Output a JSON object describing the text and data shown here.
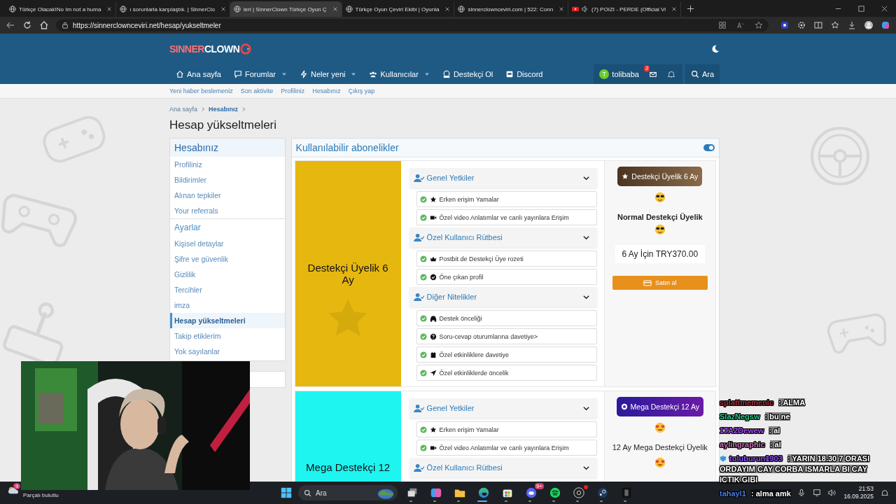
{
  "browser": {
    "tabs": [
      {
        "title": "Türkçe Olacak!No Im not a huma",
        "kind": "page",
        "selected": false,
        "audio": false
      },
      {
        "title": "ı sorunlarla karşılaştık. | SinnerClo",
        "kind": "page",
        "selected": false,
        "audio": false
      },
      {
        "title": "leri | SinnerClown Türkçe Oyun Ç",
        "kind": "page",
        "selected": true,
        "audio": false
      },
      {
        "title": "Türkçe Oyun Çeviri Ekibi | Oyunla",
        "kind": "page",
        "selected": false,
        "audio": false
      },
      {
        "title": "sinnerclownceviri.com | 522: Conn",
        "kind": "page",
        "selected": false,
        "audio": false
      },
      {
        "title": "(7) POIZI - PERDE (Official Vi",
        "kind": "video",
        "selected": false,
        "audio": true
      }
    ],
    "address": "https://sinnerclownceviri.net/hesap/yukseltmeler"
  },
  "site": {
    "logo": {
      "first": "SINNER",
      "second": "CLOWN"
    },
    "nav": [
      {
        "label": "Ana sayfa",
        "dropdown": false
      },
      {
        "label": "Forumlar",
        "dropdown": true
      },
      {
        "label": "Neler yeni",
        "dropdown": true
      },
      {
        "label": "Kullanıcılar",
        "dropdown": true
      },
      {
        "label": "Destekçi Ol",
        "dropdown": false
      },
      {
        "label": "Discord",
        "dropdown": false
      }
    ],
    "user": {
      "initial": "T",
      "name": "tolibaba",
      "mail_badge": "2"
    },
    "search": "Ara",
    "subnav": [
      "Yeni haber beslemeniz",
      "Son aktivite",
      "Profiliniz",
      "Hesabınız",
      "Çıkış yap"
    ]
  },
  "breadcrumb": [
    "Ana sayfa",
    "Hesabınız"
  ],
  "title": "Hesap yükseltmeleri",
  "sidebar": {
    "sections": [
      {
        "title": "Hesabınız",
        "items": [
          {
            "label": "Profiliniz",
            "selected": false
          },
          {
            "label": "Bildirimler",
            "selected": false
          },
          {
            "label": "Alınan tepkiler",
            "selected": false
          },
          {
            "label": "Your referrals",
            "selected": false
          }
        ]
      },
      {
        "title": "Ayarlar",
        "items": [
          {
            "label": "Kişisel detaylar",
            "selected": false
          },
          {
            "label": "Şifre ve güvenlik",
            "selected": false
          },
          {
            "label": "Gizlilik",
            "selected": false
          },
          {
            "label": "Tercihler",
            "selected": false
          },
          {
            "label": "imza",
            "selected": false
          },
          {
            "label": "Hesap yükseltmeleri",
            "selected": true
          },
          {
            "label": "Takip etiklerim",
            "selected": false
          },
          {
            "label": "Yok sayılanlar",
            "selected": false
          }
        ]
      }
    ]
  },
  "panel": {
    "title": "Kullanılabilir abonelikler",
    "toggle_on": true,
    "plans": [
      {
        "title": "Destekçi Üyelik 6 Ay",
        "color": "#e6b70f",
        "groups": [
          {
            "title": "Genel Yetkiler",
            "items": [
              "Erken erişim Yamalar",
              "Özel video Anlatımlar ve canlı yayınlara Erişim"
            ]
          },
          {
            "title": "Özel Kullanıcı Rütbesi",
            "items": [
              "Postbit de Destekçi Üye rozeti",
              "Öne çıkan profil"
            ]
          },
          {
            "title": "Diğer Nitelikler",
            "items": [
              "Destek önceliği",
              "Soru-cevap oturumlarına davetiye>",
              "Özel etkinliklere davetiye",
              "Özel etkinliklerde öncelik"
            ]
          }
        ],
        "badge": "Destekçi Üyelik 6 Ay",
        "name": "Normal Destekçi Üyelik",
        "name_bold": true,
        "price": "6 Ay İçin TRY370.00",
        "button": "Satın al"
      },
      {
        "title": "Mega Destekçi 12",
        "color": "#1ff5f0",
        "groups": [
          {
            "title": "Genel Yetkiler",
            "items": [
              "Erken erişim Yamalar",
              "Özel video Anlatımlar ve canlı yayınlara Erişim"
            ]
          },
          {
            "title": "Özel Kullanıcı Rütbesi"
          }
        ],
        "badge": "Mega Destekçi 12 Ay",
        "name": "12 Ay Mega Destekçi Üyelik",
        "name_bold": false
      }
    ]
  },
  "chat": [
    {
      "user": "splattmemenic",
      "color": "#a0303a",
      "text": ": ALMA",
      "badge": false
    },
    {
      "user": "SlazNegsw",
      "color": "#2fc08a",
      "text": ": bu ne",
      "badge": false
    },
    {
      "user": "1TA2Dewew",
      "color": "#a04ee8",
      "text": ": al",
      "badge": false
    },
    {
      "user": "aylingraphic",
      "color": "#c070b0",
      "text": ": al",
      "badge": false
    },
    {
      "user": "toluburun1903",
      "color": "#8a4ef0",
      "text": ": YARIN 18.30 7 ORASI ORDAYIM CAY CORBA ISMARLA BI CAY ICTIK GIBI",
      "badge": true
    },
    {
      "user": "tahayl1",
      "color": "#4a7ee8",
      "text": ": alma amk",
      "badge": false
    }
  ],
  "taskbar": {
    "weather_badge": "9",
    "weather": "Parçalı bulutlu",
    "search": "Ara",
    "apps": [
      {
        "kind": "task-view",
        "active": false,
        "dot": false
      },
      {
        "kind": "copilot",
        "active": false,
        "dot": false
      },
      {
        "kind": "folder",
        "active": false,
        "dot": false
      },
      {
        "kind": "edge",
        "active": true,
        "dot": false
      },
      {
        "kind": "store",
        "active": false,
        "dot": false
      },
      {
        "kind": "discord",
        "active": false,
        "dot": false,
        "badge": "9+"
      },
      {
        "kind": "spotify",
        "active": false,
        "dot": false
      },
      {
        "kind": "obs",
        "active": false,
        "dot": true
      },
      {
        "kind": "steam",
        "active": false,
        "dot": false
      },
      {
        "kind": "game",
        "active": false,
        "dot": false
      }
    ],
    "time": "21:53",
    "date": "16.09.2025"
  }
}
